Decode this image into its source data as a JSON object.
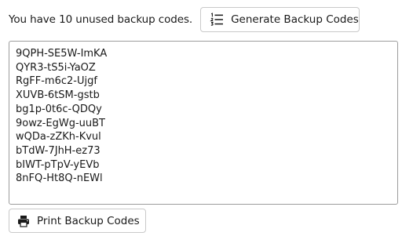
{
  "backup": {
    "status_text": "You have 10 unused backup codes.",
    "generate_label": "Generate Backup Codes",
    "print_label": "Print Backup Codes",
    "codes": [
      "9QPH-SE5W-ImKA",
      "QYR3-tS5i-YaOZ",
      "RgFF-m6c2-Ujgf",
      "XUVB-6tSM-gstb",
      "bg1p-0t6c-QDQy",
      "9owz-EgWg-uuBT",
      "wQDa-zZKh-Kvul",
      "bTdW-7JhH-ez73",
      "bIWT-pTpV-yEVb",
      "8nFQ-Ht8Q-nEWl"
    ]
  },
  "icons": {
    "generate": "numbered-list-icon",
    "print": "printer-icon"
  }
}
